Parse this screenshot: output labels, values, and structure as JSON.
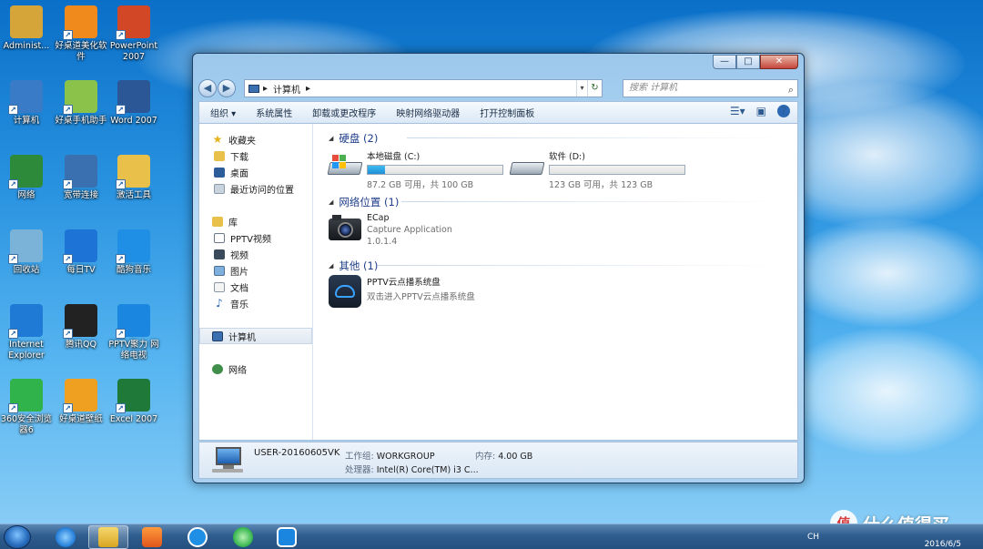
{
  "desktop": {
    "icons": [
      {
        "label": "Administ...",
        "icon": "user-folder-icon",
        "color": "#d6a53a"
      },
      {
        "label": "好桌道美化软件",
        "icon": "flower-app-icon",
        "color": "#f08a1c"
      },
      {
        "label": "PowerPoint 2007",
        "icon": "powerpoint-icon",
        "color": "#d24726"
      },
      {
        "label": "计算机",
        "icon": "computer-icon",
        "color": "#3a7bc8"
      },
      {
        "label": "好桌手机助手",
        "icon": "phone-assistant-icon",
        "color": "#8bc34a"
      },
      {
        "label": "Word 2007",
        "icon": "word-icon",
        "color": "#2b5797"
      },
      {
        "label": "网络",
        "icon": "network-icon",
        "color": "#2c8a3a"
      },
      {
        "label": "宽带连接",
        "icon": "broadband-icon",
        "color": "#3a6fb0"
      },
      {
        "label": "激活工具",
        "icon": "folder-icon",
        "color": "#e9c04a"
      },
      {
        "label": "回收站",
        "icon": "recycle-bin-icon",
        "color": "#7ab2d8"
      },
      {
        "label": "每日TV",
        "icon": "tv-app-icon",
        "color": "#1e73d6"
      },
      {
        "label": "酷狗音乐",
        "icon": "kugou-icon",
        "color": "#1f8fe6"
      },
      {
        "label": "Internet Explorer",
        "icon": "ie-icon",
        "color": "#1f7ad6"
      },
      {
        "label": "腾讯QQ",
        "icon": "qq-icon",
        "color": "#222222"
      },
      {
        "label": "PPTV聚力 网络电视",
        "icon": "pptv-icon",
        "color": "#1b86e0"
      },
      {
        "label": "360安全浏览器6",
        "icon": "360-browser-icon",
        "color": "#2fb34a"
      },
      {
        "label": "好桌道壁纸",
        "icon": "wallpaper-app-icon",
        "color": "#f0a020"
      },
      {
        "label": "Excel 2007",
        "icon": "excel-icon",
        "color": "#1f7a3a"
      }
    ]
  },
  "window": {
    "title_buttons": {
      "minimize": "—",
      "maximize": "□",
      "close": "✕"
    },
    "address": {
      "root_arrow": "▸",
      "path": "计算机",
      "path_arrow": "▸"
    },
    "search": {
      "placeholder": "搜索 计算机"
    },
    "toolbar": {
      "organize": "组织 ▾",
      "system_properties": "系统属性",
      "uninstall": "卸载或更改程序",
      "map_drive": "映射网络驱动器",
      "control_panel": "打开控制面板"
    },
    "nav": {
      "favorites": "收藏夹",
      "downloads": "下载",
      "desktop": "桌面",
      "recent": "最近访问的位置",
      "libraries": "库",
      "pptv_video": "PPTV视频",
      "videos": "视频",
      "pictures": "图片",
      "documents": "文档",
      "music": "音乐",
      "computer": "计算机",
      "network": "网络"
    },
    "groups": {
      "hard_disks": "硬盘 (2)",
      "network_locations": "网络位置 (1)",
      "other": "其他 (1)"
    },
    "drives": [
      {
        "name": "本地磁盘 (C:)",
        "free": "87.2 GB 可用，共 100 GB",
        "used_fraction": 0.128
      },
      {
        "name": "软件 (D:)",
        "free": "123 GB 可用，共 123 GB",
        "used_fraction": 0.0
      }
    ],
    "network_item": {
      "name": "ECap",
      "desc": "Capture Application",
      "version": "1.0.1.4"
    },
    "other_item": {
      "name": "PPTV云点播系统盘",
      "desc": "双击进入PPTV云点播系统盘"
    },
    "details": {
      "computer_name": "USER-20160605VK",
      "workgroup_label": "工作组:",
      "workgroup": "WORKGROUP",
      "memory_label": "内存:",
      "memory": "4.00 GB",
      "cpu_label": "处理器:",
      "cpu": "Intel(R) Core(TM) i3 C..."
    }
  },
  "taskbar": {
    "lang": "CH",
    "date": "2016/6/5"
  },
  "watermark": {
    "badge": "值",
    "text": "什么值得买"
  }
}
